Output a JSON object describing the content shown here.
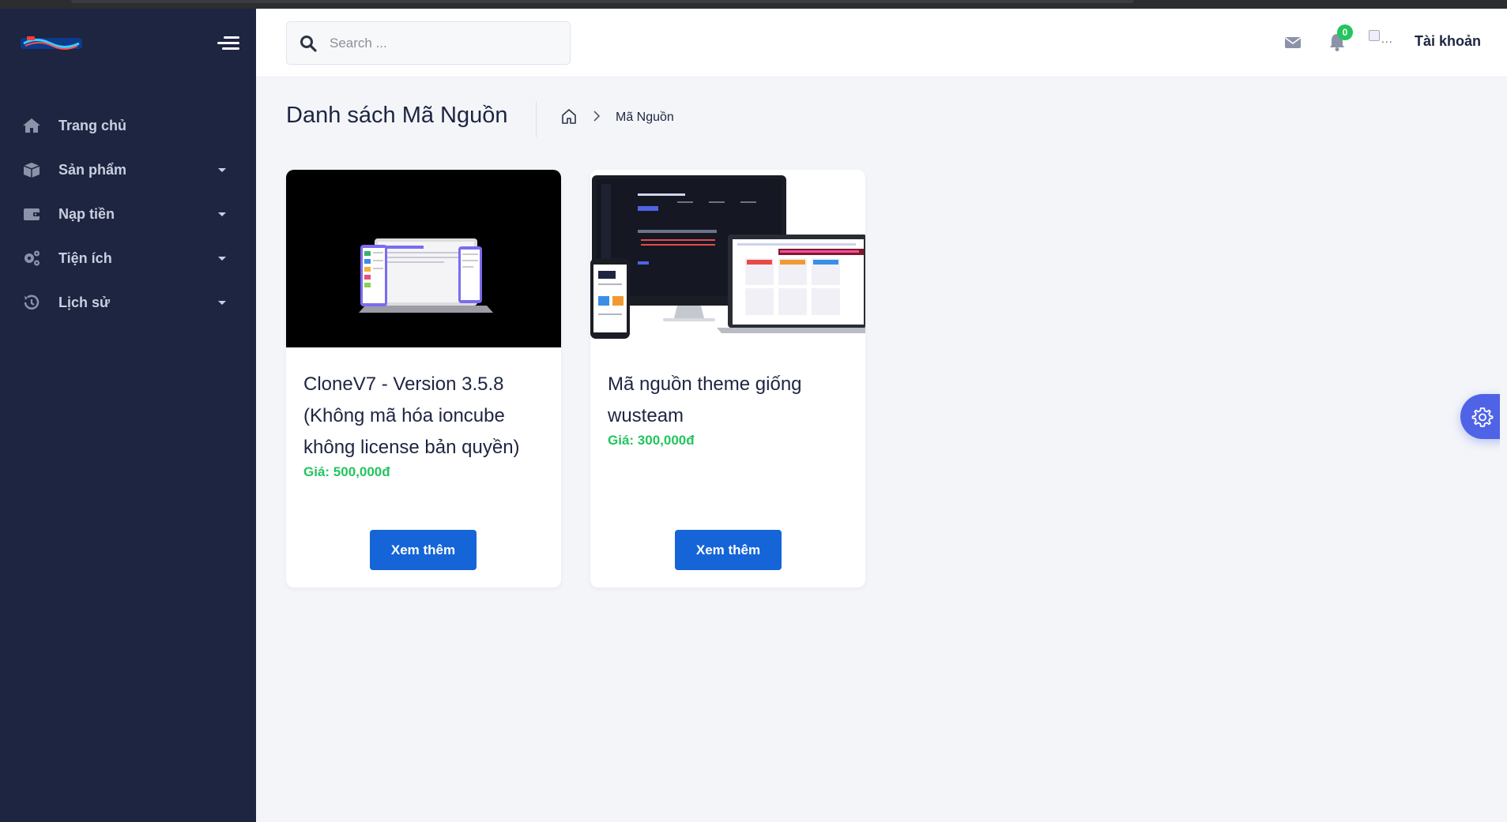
{
  "header": {
    "search_placeholder": "Search ...",
    "notification_count": "0",
    "avatar_alt": "...",
    "account_label": "Tài khoản"
  },
  "sidebar": {
    "items": [
      {
        "label": "Trang chủ",
        "icon": "home-icon",
        "has_dropdown": false
      },
      {
        "label": "Sản phẩm",
        "icon": "box-icon",
        "has_dropdown": true
      },
      {
        "label": "Nạp tiền",
        "icon": "wallet-icon",
        "has_dropdown": true
      },
      {
        "label": "Tiện ích",
        "icon": "cogs-icon",
        "has_dropdown": true
      },
      {
        "label": "Lịch sử",
        "icon": "history-icon",
        "has_dropdown": true
      }
    ]
  },
  "page": {
    "title": "Danh sách Mã Nguồn",
    "breadcrumb_current": "Mã Nguồn"
  },
  "products": [
    {
      "title": "CloneV7 - Version 3.5.8 (Không mã hóa ioncube không license bản quyền)",
      "price": "Giá: 500,000đ",
      "button": "Xem thêm"
    },
    {
      "title": "Mã nguồn theme giống wusteam",
      "price": "Giá: 300,000đ",
      "button": "Xem thêm"
    }
  ],
  "colors": {
    "sidebar_bg": "#1e2541",
    "accent_button": "#1565d8",
    "price_green": "#22c55e",
    "settings_fab": "#4f63e6"
  }
}
